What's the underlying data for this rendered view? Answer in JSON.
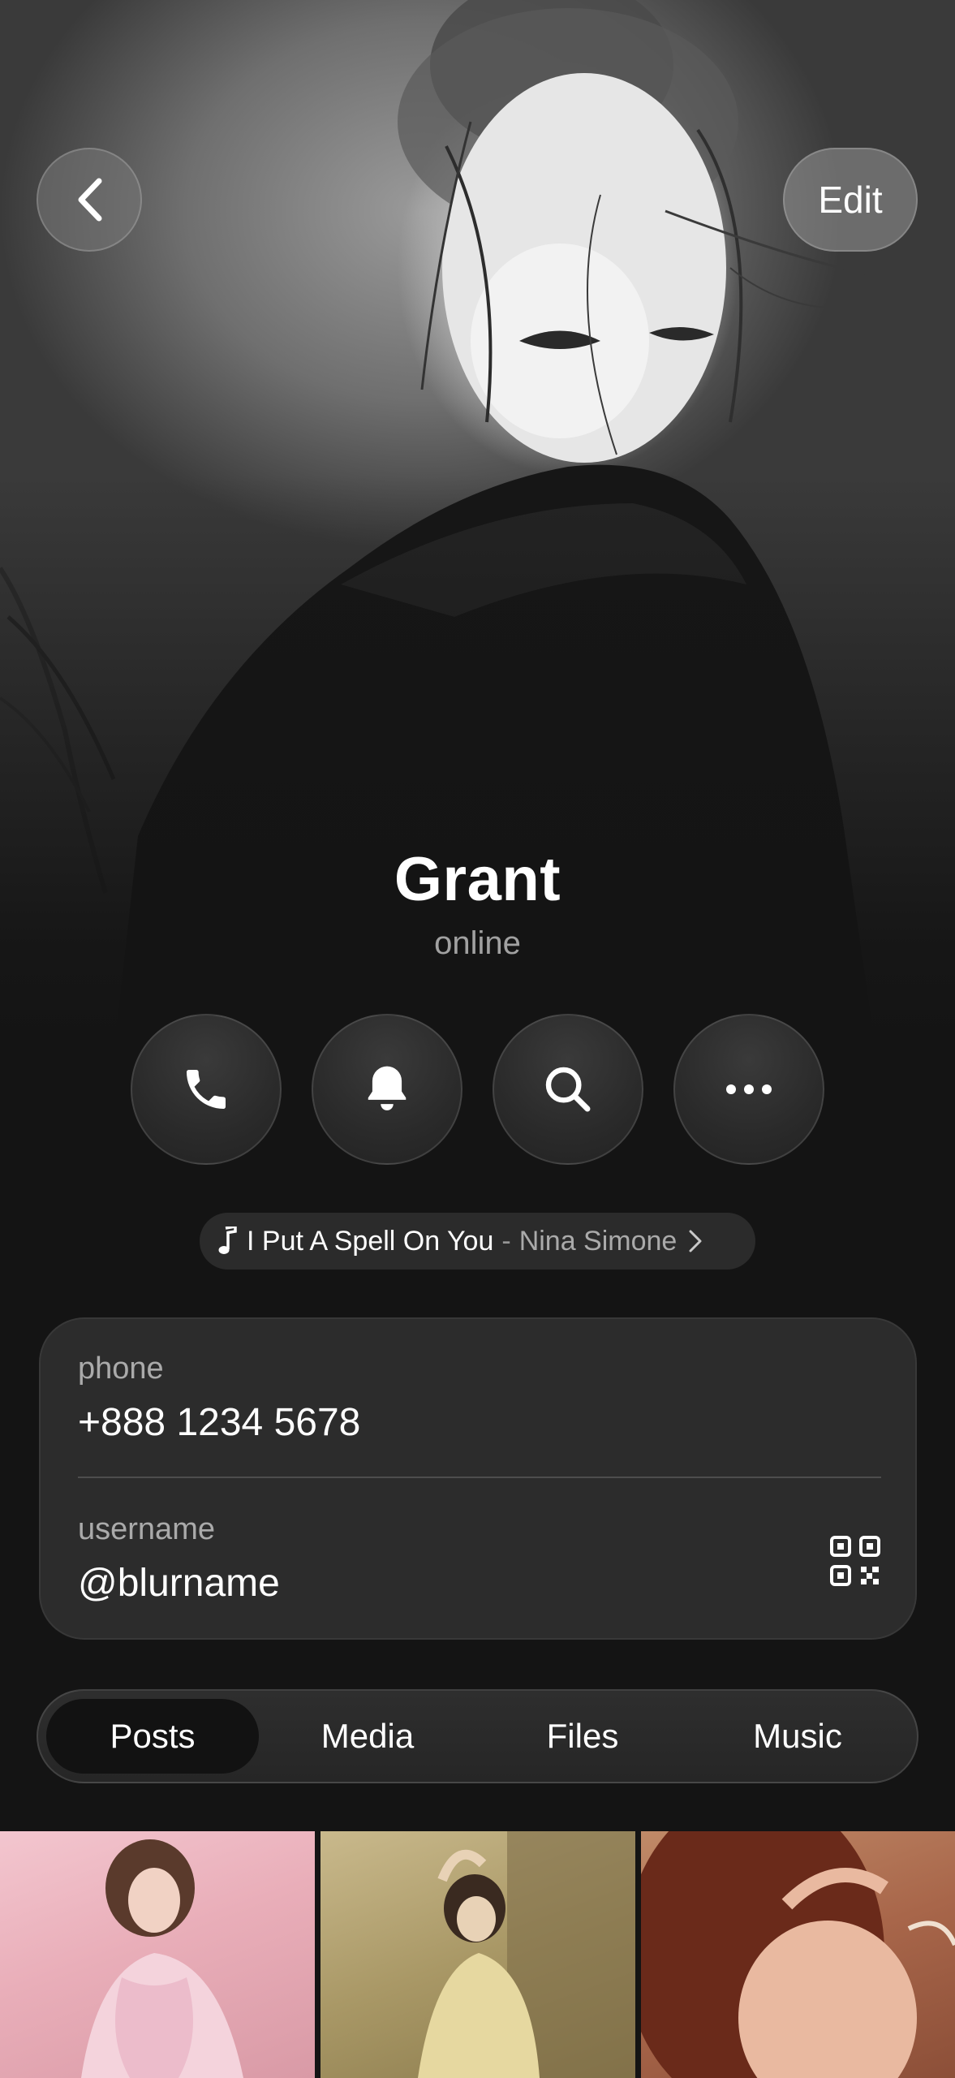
{
  "header": {
    "back_icon": "chevron-left-icon",
    "edit_label": "Edit"
  },
  "profile": {
    "name": "Grant",
    "status": "online"
  },
  "actions": [
    {
      "icon": "phone-icon"
    },
    {
      "icon": "bell-icon"
    },
    {
      "icon": "search-icon"
    },
    {
      "icon": "more-icon"
    }
  ],
  "music": {
    "icon": "music-note-icon",
    "song": "I Put A Spell On You",
    "separator": "-",
    "artist": "Nina Simone"
  },
  "info": {
    "phone_label": "phone",
    "phone_value": "+888 1234 5678",
    "username_label": "username",
    "username_value": "@blurname",
    "qr_icon": "qr-code-icon"
  },
  "tabs": [
    {
      "label": "Posts",
      "active": true
    },
    {
      "label": "Media",
      "active": false
    },
    {
      "label": "Files",
      "active": false
    },
    {
      "label": "Music",
      "active": false
    }
  ],
  "colors": {
    "background": "#141414",
    "card": "#2c2c2c",
    "active_tab": "#121212",
    "secondary_text": "#999999"
  }
}
